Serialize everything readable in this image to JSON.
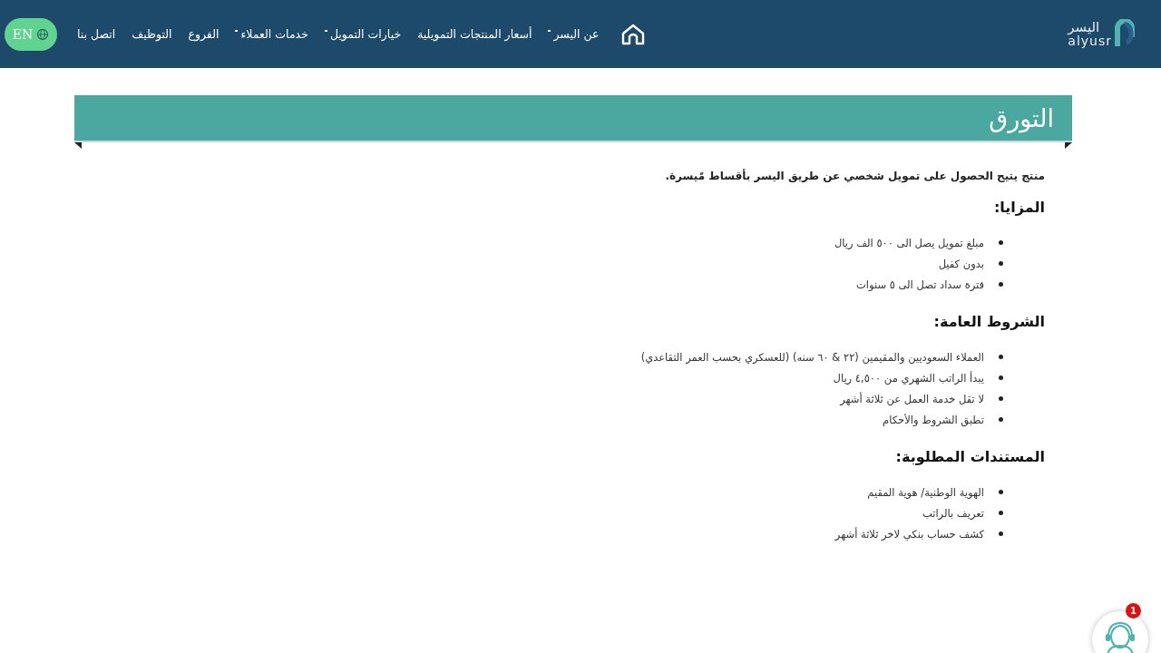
{
  "header": {
    "logo": {
      "arabic": "اليسر",
      "latin": "alyusr"
    },
    "nav": [
      {
        "label": "عن اليسر",
        "has_dropdown": true
      },
      {
        "label": "أسعار المنتجات التمويلية",
        "has_dropdown": false
      },
      {
        "label": "خيارات التمويل",
        "has_dropdown": true
      },
      {
        "label": "خدمات العملاء",
        "has_dropdown": true
      },
      {
        "label": "الفروع",
        "has_dropdown": false
      },
      {
        "label": "التوظيف",
        "has_dropdown": false
      },
      {
        "label": "اتصل بنا",
        "has_dropdown": false
      }
    ],
    "language_button": "EN"
  },
  "page_title": "التورق",
  "intro": "منتج يتيح الحصول على تمويل شخصي عن طريق اليسر بأقساط مًيسرة.",
  "sections": [
    {
      "heading": "المزايا:",
      "items": [
        "مبلغ تمويل يصل الى ٥٠٠ الف ريال",
        "بدون كفيل",
        "فترة سداد تصل الى ٥ سنوات"
      ]
    },
    {
      "heading": "الشروط العامة:",
      "items": [
        "العملاء السعوديين والمقيمين (٢٢ & ٦٠ سنه) (للعسكري بحسب العمر التقاعدي)",
        "يبدأ الراتب الشهري من ٤,٥٠٠ ريال",
        "لا تقل خدمة العمل عن ثلاثة أشهر",
        "تطبق الشروط والأحكام"
      ]
    },
    {
      "heading": "المستندات المطلوبة:",
      "items": [
        "الهوية الوطنية/ هوية المقيم",
        "تعريف بالراتب",
        "كشف حساب بنكي لاخر ثلاثة أشهر"
      ]
    }
  ],
  "chat_widget": {
    "badge": "1"
  }
}
